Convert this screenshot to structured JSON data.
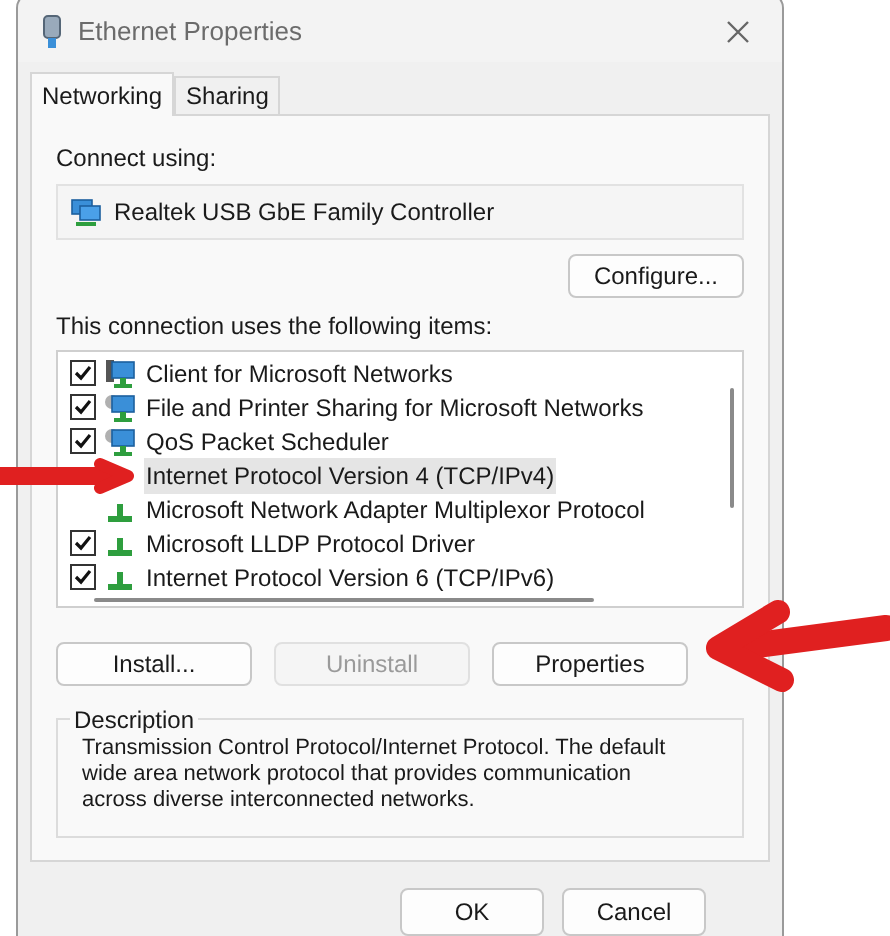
{
  "window": {
    "title": "Ethernet Properties"
  },
  "tabs": [
    {
      "label": "Networking",
      "selected": true
    },
    {
      "label": "Sharing",
      "selected": false
    }
  ],
  "connect_using": {
    "label": "Connect using:",
    "adapter": "Realtek USB GbE Family Controller",
    "button": "Configure..."
  },
  "items_label": "This connection uses the following items:",
  "items": [
    {
      "kind": "client",
      "label": "Client for Microsoft Networks",
      "checked": true,
      "selected": false
    },
    {
      "kind": "service",
      "label": "File and Printer Sharing for Microsoft Networks",
      "checked": true,
      "selected": false
    },
    {
      "kind": "service",
      "label": "QoS Packet Scheduler",
      "checked": true,
      "selected": false
    },
    {
      "label": "Internet Protocol Version 4 (TCP/IPv4)",
      "selected": true
    },
    {
      "kind": "protocol",
      "label": "Microsoft Network Adapter Multiplexor Protocol",
      "selected": false
    },
    {
      "kind": "protocol",
      "label": "Microsoft LLDP Protocol Driver",
      "checked": true,
      "selected": false
    },
    {
      "kind": "protocol",
      "label": "Internet Protocol Version 6 (TCP/IPv6)",
      "checked": true,
      "selected": false
    }
  ],
  "item_buttons": [
    {
      "label": "Install...",
      "disabled": false
    },
    {
      "label": "Uninstall",
      "disabled": true
    },
    {
      "label": "Properties",
      "disabled": false
    }
  ],
  "description": {
    "title": "Description",
    "text": "Transmission Control Protocol/Internet Protocol. The default wide area network protocol that provides communication across diverse interconnected networks."
  },
  "dialog_buttons": [
    "OK",
    "Cancel"
  ]
}
